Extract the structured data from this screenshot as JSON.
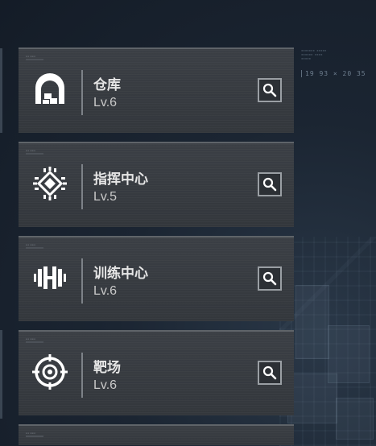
{
  "deco": {
    "readout": "19 93 × 20 35"
  },
  "facilities": [
    {
      "name": "仓库",
      "level": "Lv.6",
      "icon": "warehouse-icon"
    },
    {
      "name": "指挥中心",
      "level": "Lv.5",
      "icon": "chip-icon"
    },
    {
      "name": "训练中心",
      "level": "Lv.6",
      "icon": "dumbbell-icon"
    },
    {
      "name": "靶场",
      "level": "Lv.6",
      "icon": "target-icon"
    }
  ],
  "colors": {
    "background": "#1b2532",
    "card": "#383c41",
    "text": "#e6e6e6"
  }
}
